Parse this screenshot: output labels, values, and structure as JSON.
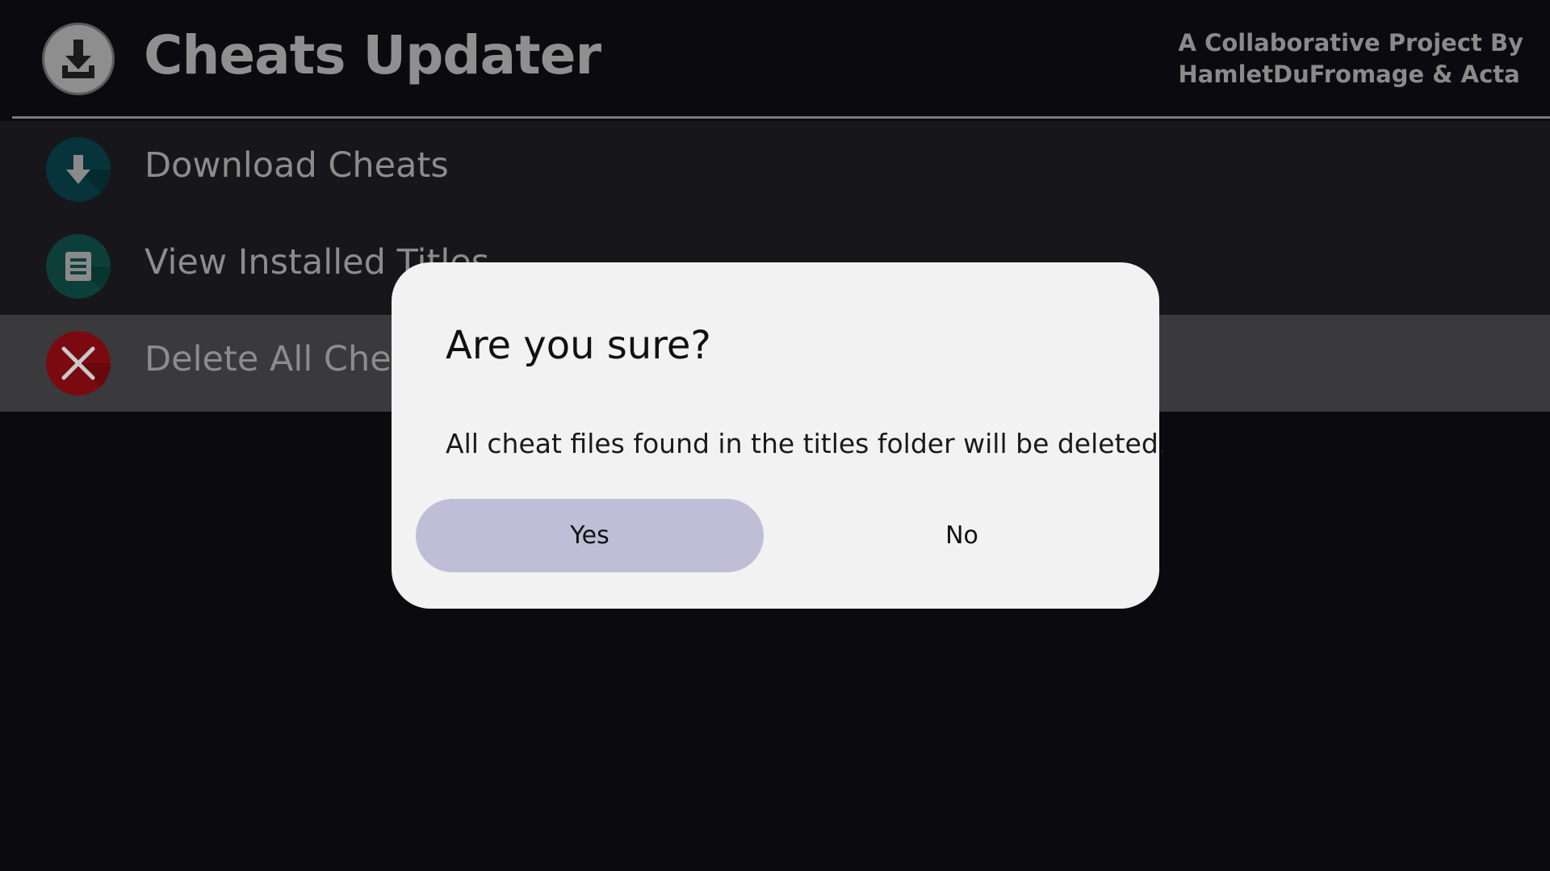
{
  "header": {
    "title": "Cheats Updater",
    "credits_line1": "A Collaborative Project By",
    "credits_line2": "HamletDuFromage & Acta",
    "logo_icon": "download-circle-icon"
  },
  "menu": {
    "items": [
      {
        "label": "Download Cheats",
        "icon": "download-arrow-icon",
        "color": "#06343a",
        "selected": false
      },
      {
        "label": "View Installed Titles",
        "icon": "document-icon",
        "color": "#0c3f3a",
        "selected": false
      },
      {
        "label": "Delete All Cheats",
        "icon": "close-x-icon",
        "color": "#7a0a10",
        "selected": true
      }
    ]
  },
  "dialog": {
    "title": "Are you sure?",
    "message": "All cheat files found in the titles folder will be deleted.",
    "yes_label": "Yes",
    "no_label": "No",
    "focused": "Yes",
    "focus_color": "#c0bed6"
  }
}
